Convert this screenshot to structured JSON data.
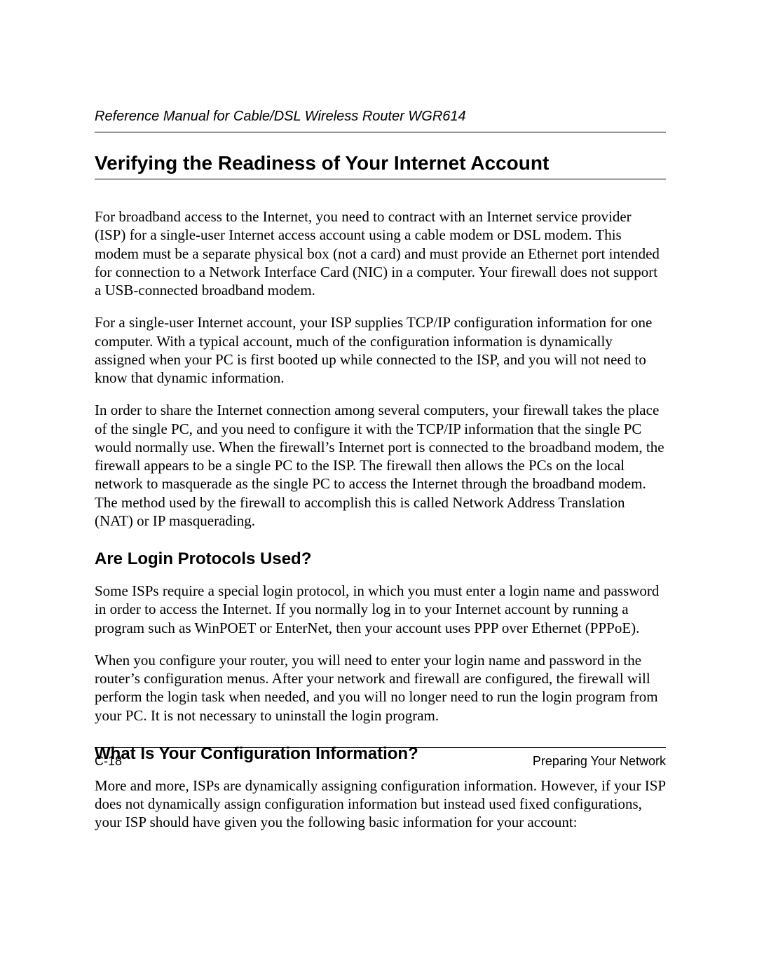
{
  "header": {
    "running_title": "Reference Manual for Cable/DSL Wireless Router WGR614"
  },
  "main": {
    "h1": "Verifying the Readiness of Your Internet Account",
    "p1": "For broadband access to the Internet, you need to contract with an Internet service provider (ISP) for a single-user Internet access account using a cable modem or DSL modem. This modem must be a separate physical box (not a card) and must provide an Ethernet port intended for connection to a Network Interface Card (NIC) in a computer. Your firewall does not support a USB-connected broadband modem.",
    "p2": "For a single-user Internet account, your ISP supplies TCP/IP configuration information for one computer. With a typical account, much of the configuration information is dynamically assigned when your PC is first booted up while connected to the ISP, and you will not need to know that dynamic information.",
    "p3": "In order to share the Internet connection among several computers, your firewall takes the place of the single PC, and you need to configure it with the TCP/IP information that the single PC would normally use. When the firewall’s Internet port is connected to the broadband modem, the firewall appears to be a single PC to the ISP. The firewall then allows the PCs on the local network to masquerade as the single PC to access the Internet through the broadband modem. The method used by the firewall to accomplish this is called Network Address Translation (NAT) or IP masquerading.",
    "h2a": "Are Login Protocols Used?",
    "p4": "Some ISPs require a special login protocol, in which you must enter a login name and password in order to access the Internet. If you normally log in to your Internet account by running a program such as WinPOET or EnterNet, then your account uses PPP over Ethernet (PPPoE).",
    "p5": "When you configure your router, you will need to enter your login name and password in the router’s configuration menus. After your network and firewall are configured, the firewall will perform the login task when needed, and you will no longer need to run the login program from your PC. It is not necessary to uninstall the login program.",
    "h2b": "What Is Your Configuration Information?",
    "p6": "More and more, ISPs are dynamically assigning configuration information. However, if your ISP does not dynamically assign configuration information but instead used fixed configurations, your ISP should have given you the following basic information for your account:"
  },
  "footer": {
    "page_number": "C-18",
    "section_label": "Preparing Your Network"
  }
}
